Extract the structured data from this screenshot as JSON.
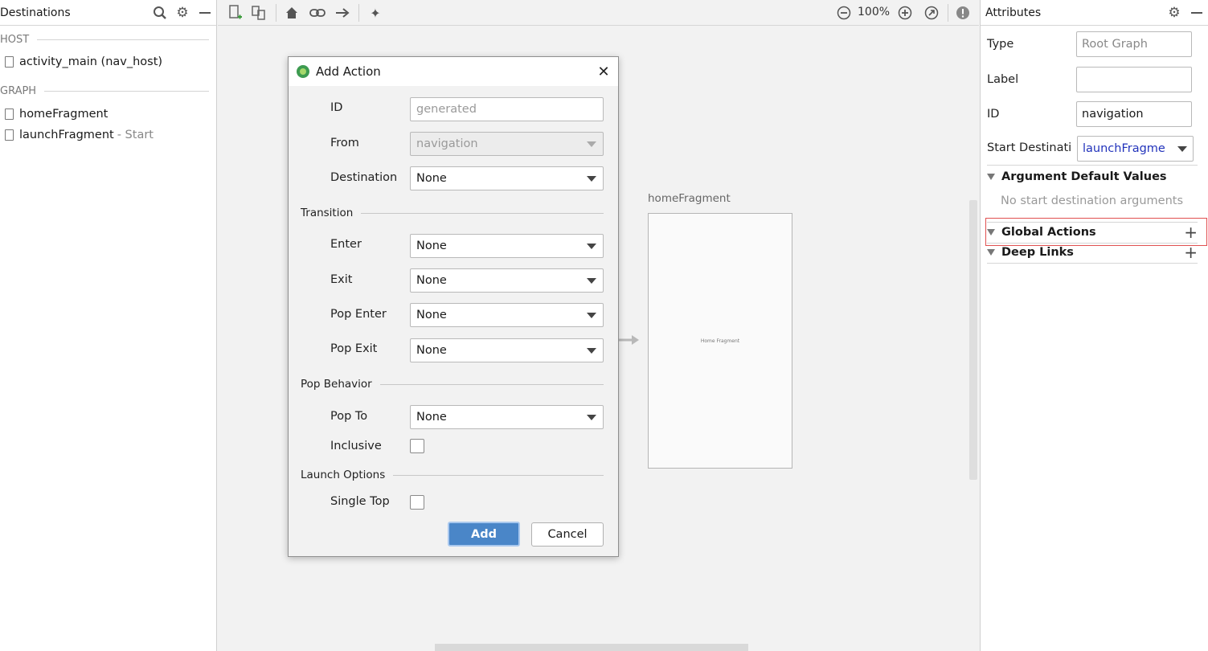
{
  "left_panel": {
    "title": "Destinations",
    "sections": [
      {
        "label": "HOST",
        "items": [
          {
            "label": "activity_main (nav_host)",
            "sub": ""
          }
        ]
      },
      {
        "label": "GRAPH",
        "items": [
          {
            "label": "homeFragment",
            "sub": ""
          },
          {
            "label": "launchFragment",
            "sub": "- Start"
          }
        ]
      }
    ]
  },
  "toolbar": {
    "zoom": "100%"
  },
  "canvas": {
    "destination_label": "homeFragment",
    "destination_preview_text": "Home Fragment"
  },
  "dialog": {
    "title": "Add Action",
    "fields": {
      "id": {
        "label": "ID",
        "placeholder": "generated"
      },
      "from": {
        "label": "From",
        "value": "navigation"
      },
      "destination": {
        "label": "Destination",
        "value": "None"
      }
    },
    "transition": {
      "title": "Transition",
      "enter": {
        "label": "Enter",
        "value": "None"
      },
      "exit": {
        "label": "Exit",
        "value": "None"
      },
      "pop_enter": {
        "label": "Pop Enter",
        "value": "None"
      },
      "pop_exit": {
        "label": "Pop Exit",
        "value": "None"
      }
    },
    "pop_behavior": {
      "title": "Pop Behavior",
      "pop_to": {
        "label": "Pop To",
        "value": "None"
      },
      "inclusive": {
        "label": "Inclusive",
        "checked": false
      }
    },
    "launch_options": {
      "title": "Launch Options",
      "single_top": {
        "label": "Single Top",
        "checked": false
      }
    },
    "add_label": "Add",
    "cancel_label": "Cancel"
  },
  "attributes": {
    "title": "Attributes",
    "type": {
      "label": "Type",
      "value": "Root Graph"
    },
    "label": {
      "label": "Label",
      "value": ""
    },
    "id": {
      "label": "ID",
      "value": "navigation"
    },
    "start_destination": {
      "label": "Start Destinati",
      "value": "launchFragme"
    },
    "argument_defaults": {
      "title": "Argument Default Values",
      "empty": "No start destination arguments"
    },
    "global_actions": {
      "title": "Global Actions"
    },
    "deep_links": {
      "title": "Deep Links"
    }
  }
}
